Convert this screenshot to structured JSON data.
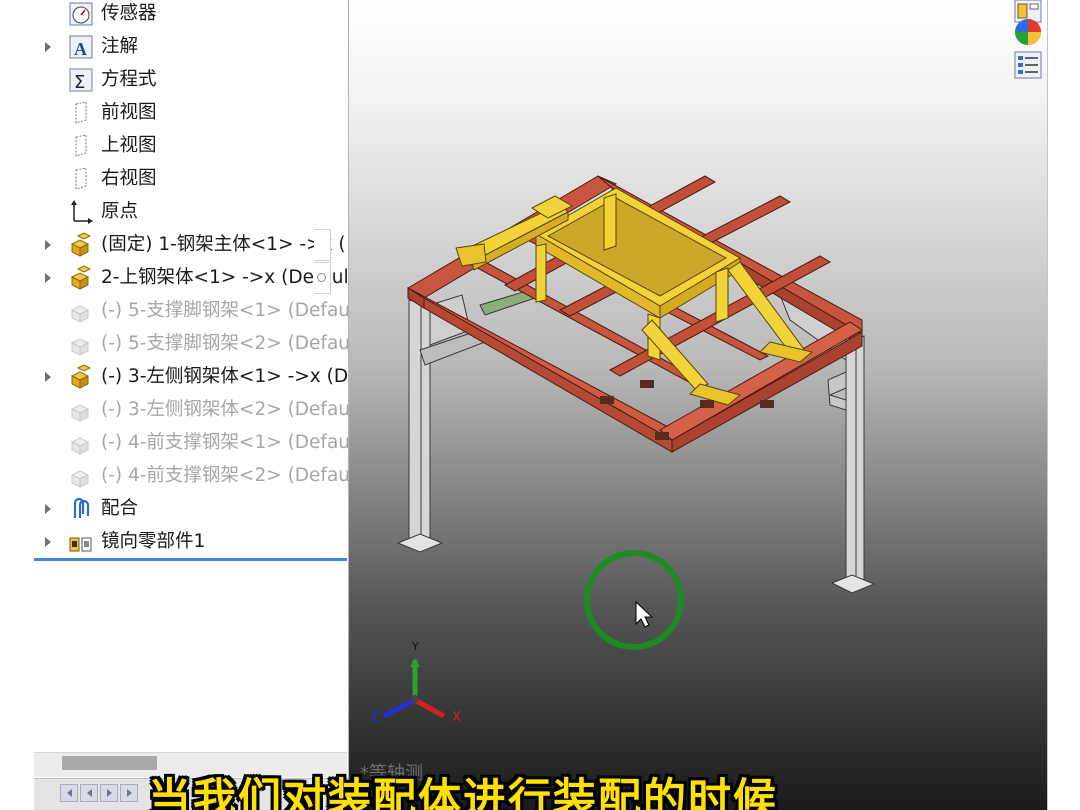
{
  "feature_tree": {
    "items": [
      {
        "label": "传感器",
        "icon": "sensor-icon",
        "expandable": false,
        "state": "normal"
      },
      {
        "label": "注解",
        "icon": "annotation-icon",
        "expandable": true,
        "state": "normal"
      },
      {
        "label": "方程式",
        "icon": "equation-icon",
        "expandable": false,
        "state": "normal"
      },
      {
        "label": "前视图",
        "icon": "plane-icon",
        "expandable": false,
        "state": "normal"
      },
      {
        "label": "上视图",
        "icon": "plane-icon",
        "expandable": false,
        "state": "normal"
      },
      {
        "label": "右视图",
        "icon": "plane-icon",
        "expandable": false,
        "state": "normal"
      },
      {
        "label": "原点",
        "icon": "origin-icon",
        "expandable": false,
        "state": "normal"
      },
      {
        "label": "(固定) 1-钢架主体<1> ->x (",
        "icon": "subassembly-icon",
        "expandable": true,
        "state": "normal"
      },
      {
        "label": "2-上钢架体<1> ->x (Defaul",
        "icon": "subassembly-icon",
        "expandable": true,
        "state": "normal"
      },
      {
        "label": "(-) 5-支撑脚钢架<1> (Defau",
        "icon": "part-icon",
        "expandable": false,
        "state": "suppressed"
      },
      {
        "label": "(-) 5-支撑脚钢架<2> (Defau",
        "icon": "part-icon",
        "expandable": false,
        "state": "suppressed"
      },
      {
        "label": "(-) 3-左侧钢架体<1> ->x (D",
        "icon": "subassembly-icon",
        "expandable": true,
        "state": "normal"
      },
      {
        "label": "(-) 3-左侧钢架体<2> (Defau",
        "icon": "part-icon",
        "expandable": false,
        "state": "suppressed"
      },
      {
        "label": "(-) 4-前支撑钢架<1> (Defau",
        "icon": "part-icon",
        "expandable": false,
        "state": "suppressed"
      },
      {
        "label": "(-) 4-前支撑钢架<2> (Defau",
        "icon": "part-icon",
        "expandable": false,
        "state": "suppressed"
      },
      {
        "label": "配合",
        "icon": "mates-icon",
        "expandable": true,
        "state": "normal"
      },
      {
        "label": "镜向零部件1",
        "icon": "mirror-components-icon",
        "expandable": true,
        "state": "normal"
      }
    ]
  },
  "viewport": {
    "view_name": "*等轴测",
    "triad": {
      "x": "X",
      "y": "Y",
      "z": "Z"
    },
    "colors": {
      "frame_red": "#c8553d",
      "frame_yellow": "#f2d43a",
      "legs_gray": "#d4d4d4",
      "cursor_ring": "#1d8a22"
    }
  },
  "task_pane": {
    "icons": [
      "design-library-icon",
      "appearances-icon",
      "custom-properties-icon"
    ]
  },
  "caption": {
    "text": "当我们对装配体进行装配的时候"
  }
}
